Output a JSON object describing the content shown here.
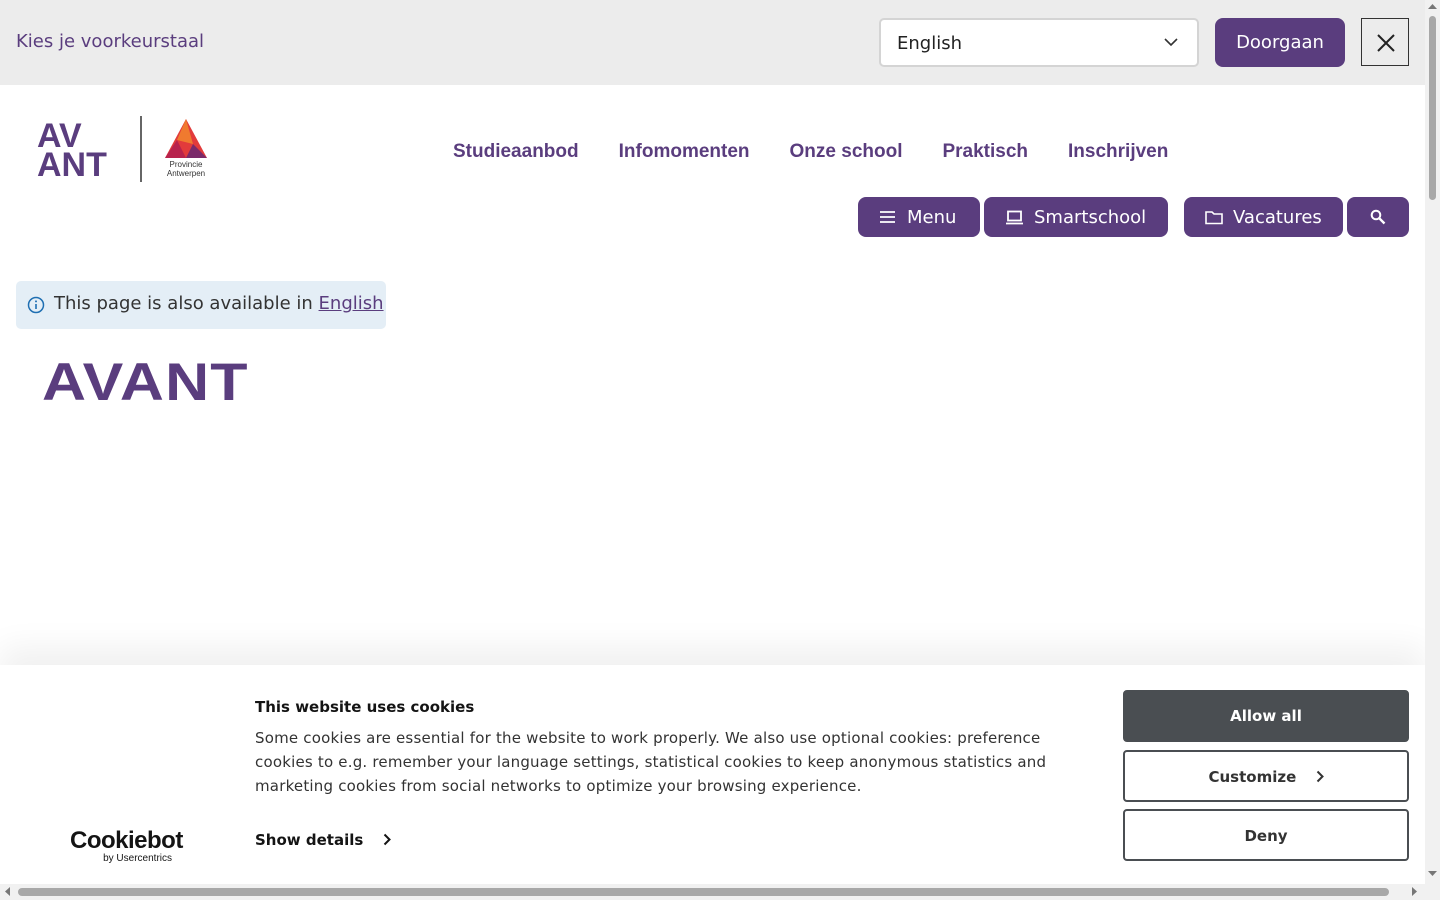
{
  "language_bar": {
    "prompt": "Kies je voorkeurstaal",
    "selected_language": "English",
    "continue_label": "Doorgaan"
  },
  "logo": {
    "wordmark_line1": "AV",
    "wordmark_line2": "ANT",
    "partner_line1": "Provincie",
    "partner_line2": "Antwerpen"
  },
  "nav": {
    "items": [
      {
        "label": "Studieaanbod"
      },
      {
        "label": "Infomomenten"
      },
      {
        "label": "Onze school"
      },
      {
        "label": "Praktisch"
      },
      {
        "label": "Inschrijven"
      }
    ]
  },
  "actions": {
    "menu_label": "Menu",
    "smartschool_label": "Smartschool",
    "vacatures_label": "Vacatures"
  },
  "notice": {
    "text": "This page is also available in",
    "link_text": "English"
  },
  "page": {
    "title": "AVANT"
  },
  "cookie_banner": {
    "brand_name": "Cookiebot",
    "brand_sub": "by Usercentrics",
    "title": "This website uses cookies",
    "body": "Some cookies are essential for the website to work properly. We also use optional cookies: preference cookies to e.g. remember your language settings, statistical cookies to keep anonymous statistics and marketing cookies from social networks to optimize your browsing experience.",
    "show_details_label": "Show details",
    "allow_all_label": "Allow all",
    "customize_label": "Customize",
    "deny_label": "Deny"
  },
  "colors": {
    "brand_purple": "#5a3d7e",
    "cookie_dark": "#4a4e52",
    "notice_bg": "#e4eef6",
    "langbar_bg": "#ececec"
  },
  "icons": [
    "chevron-down-icon",
    "close-icon",
    "hamburger-icon",
    "laptop-icon",
    "folder-icon",
    "search-icon",
    "info-icon",
    "chevron-right-icon"
  ]
}
